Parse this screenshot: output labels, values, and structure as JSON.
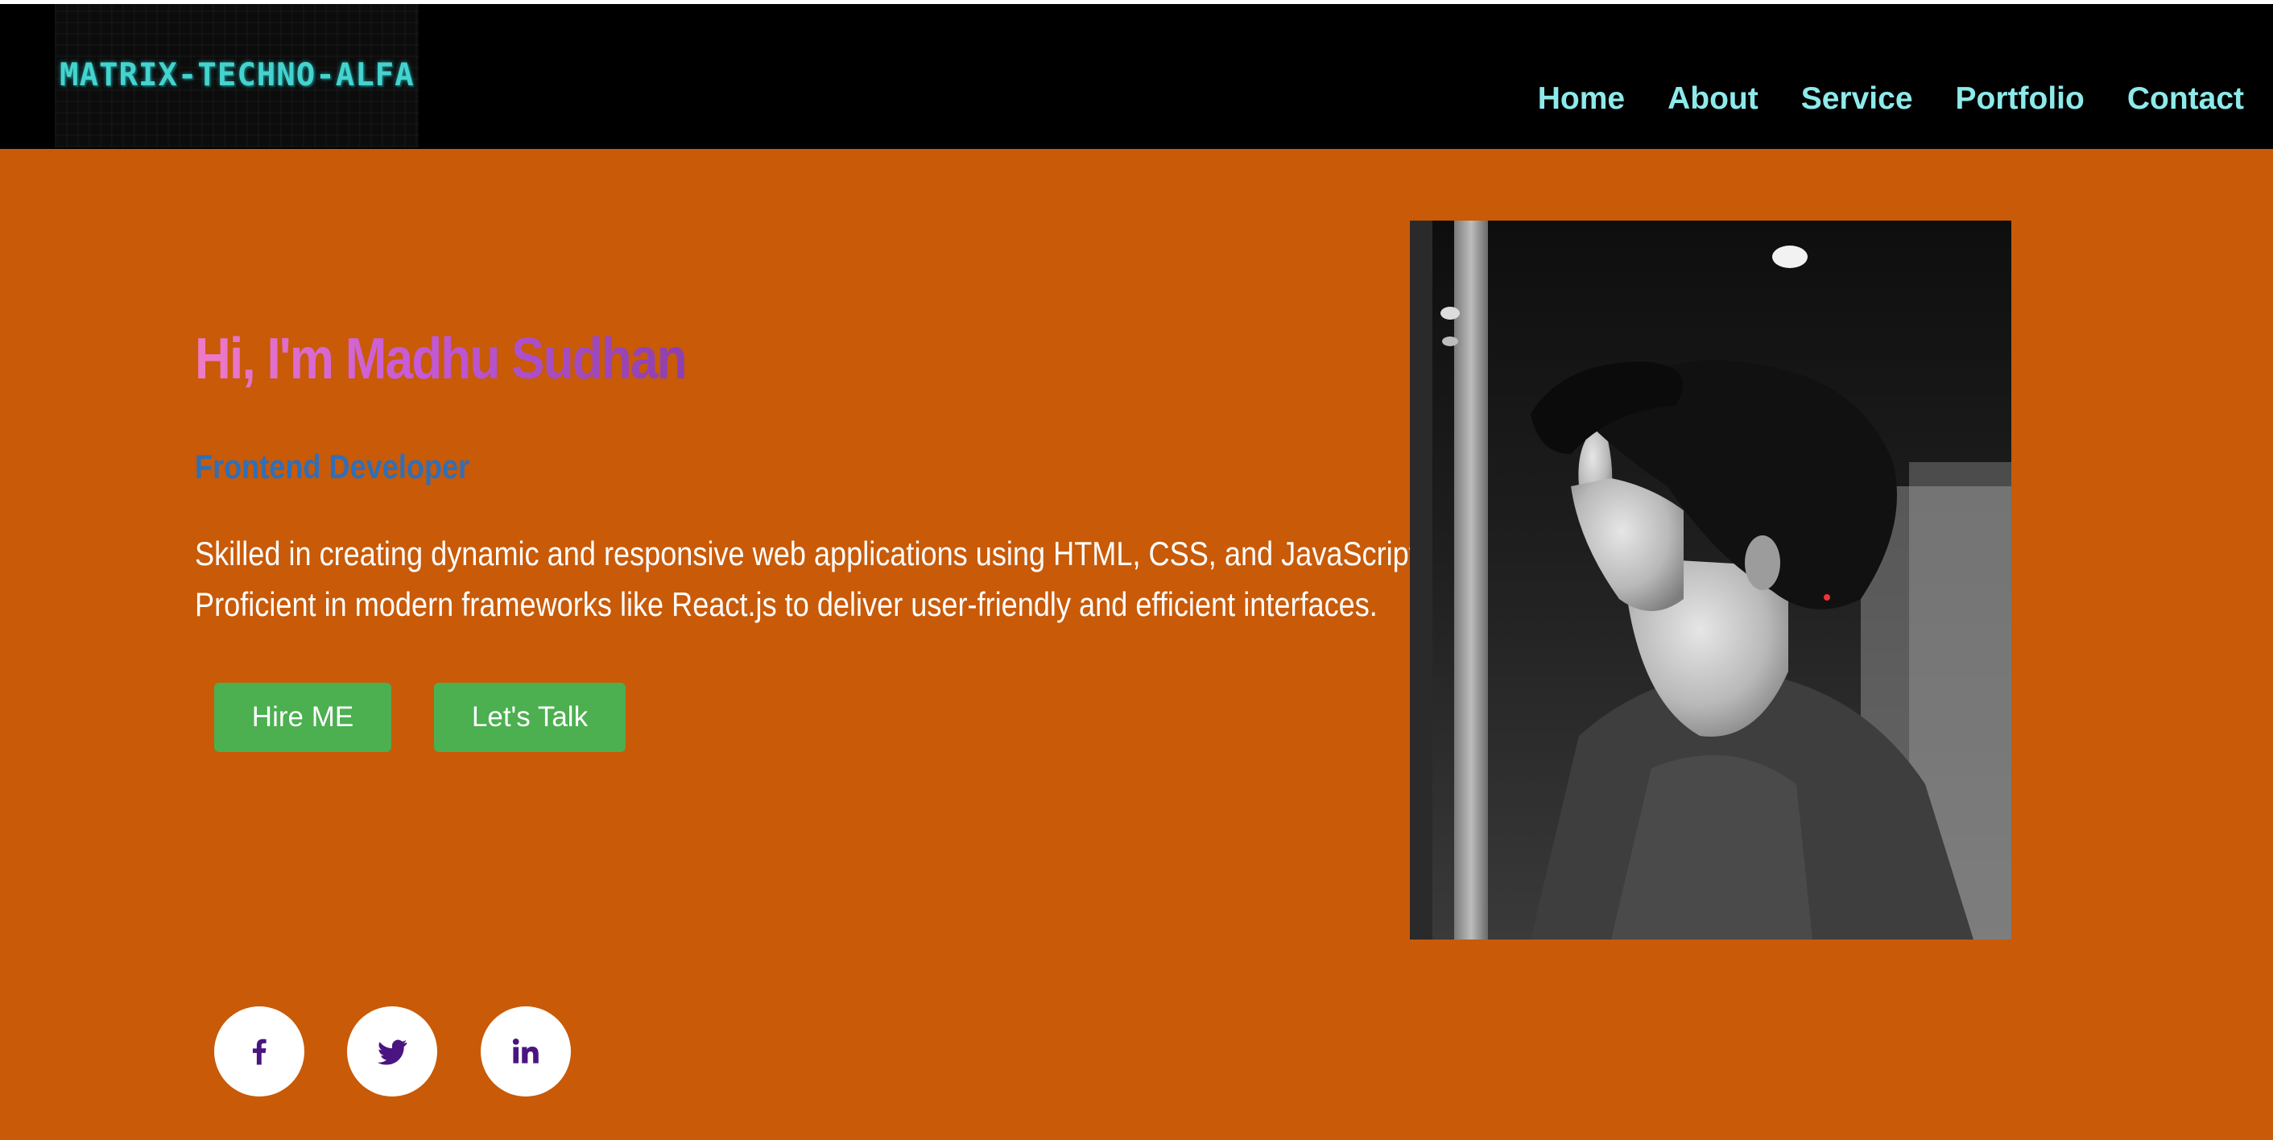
{
  "nav": {
    "logo": "MATRIX-TECHNO-ALFA",
    "links": [
      "Home",
      "About",
      "Service",
      "Portfolio",
      "Contact"
    ]
  },
  "hero": {
    "greeting": "Hi, I'm Madhu Sudhan",
    "role": "Frontend Developer",
    "description_line1": "Skilled in creating dynamic and responsive web applications using HTML, CSS, and JavaScript.",
    "description_line2": "Proficient in modern frameworks like React.js to deliver user-friendly and efficient interfaces.",
    "hire_button": "Hire ME",
    "talk_button": "Let's Talk"
  },
  "social": {
    "icons": [
      "facebook-icon",
      "twitter-icon",
      "linkedin-icon"
    ]
  },
  "colors": {
    "page_background": "#c85a08",
    "navbar": "#000000",
    "nav_link": "#8eeaea",
    "logo": "#45d3cf",
    "button": "#4caf50",
    "role": "#2f6fb8",
    "social_icon": "#4a1580"
  }
}
